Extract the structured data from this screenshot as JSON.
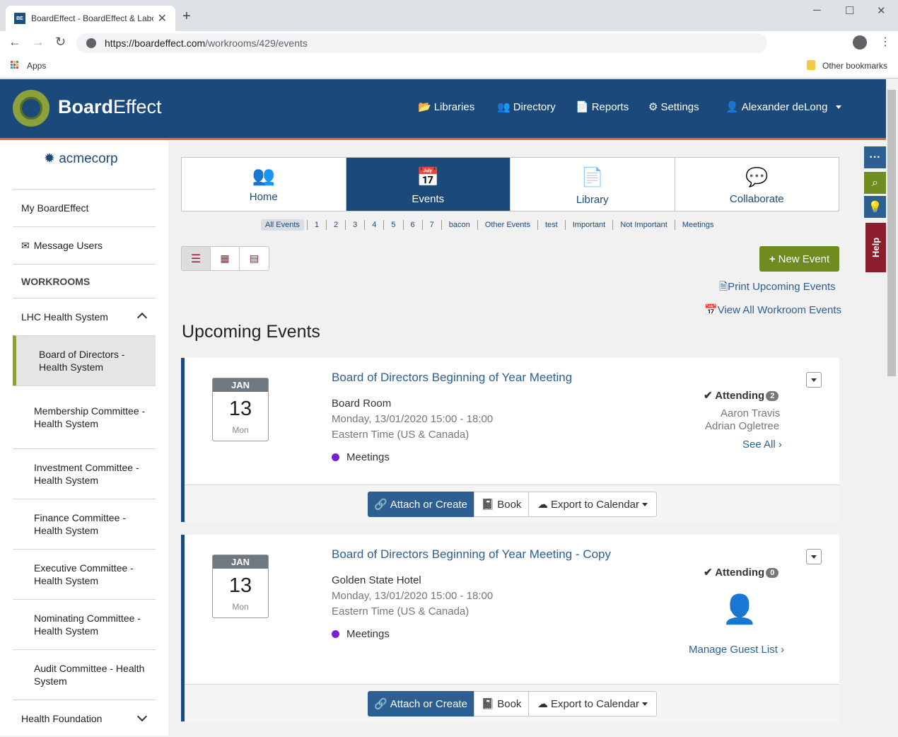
{
  "browser": {
    "tab_title": "BoardEffect - BoardEffect & Labo",
    "favicon_text": "BE",
    "url_host": "https://boardeffect.com",
    "url_path": "/workrooms/429/events",
    "bookmarks_apps": "Apps",
    "bookmarks_other": "Other bookmarks"
  },
  "header": {
    "logo_board": "Board",
    "logo_effect": "Effect",
    "nav": {
      "libraries": "Libraries",
      "directory": "Directory",
      "reports": "Reports",
      "settings": "Settings",
      "user": "Alexander deLong"
    }
  },
  "sidebar": {
    "brand": "acmecorp",
    "my_boardeffect": "My BoardEffect",
    "message_users": "Message Users",
    "workrooms_heading": "WORKROOMS",
    "group1": "LHC Health System",
    "items": [
      "Board of Directors - Health System",
      "Membership Committee - Health System",
      "Investment Committee - Health System",
      "Finance Committee - Health System",
      "Executive Committee - Health System",
      "Nominating Committee - Health System",
      "Audit Committee - Health System"
    ],
    "group2": "Health Foundation"
  },
  "tabs": {
    "home": "Home",
    "events": "Events",
    "library": "Library",
    "collaborate": "Collaborate"
  },
  "filters": [
    "All Events",
    "1",
    "2",
    "3",
    "4",
    "5",
    "6",
    "7",
    "bacon",
    "Other Events",
    "test",
    "Important",
    "Not Important",
    "Meetings"
  ],
  "actions": {
    "new_event": "New Event",
    "print_upcoming": "Print Upcoming Events",
    "view_all": "View All Workroom Events"
  },
  "section_title": "Upcoming Events",
  "events": [
    {
      "month": "JAN",
      "day": "13",
      "weekday": "Mon",
      "title": "Board of Directors Beginning of Year Meeting",
      "location": "Board Room",
      "time": "Monday, 13/01/2020 15:00 - 18:00",
      "timezone": "Eastern Time (US & Canada)",
      "category": "Meetings",
      "attending_label": "Attending",
      "attending_count": "2",
      "attendees": [
        "Aaron Travis",
        "Adrian Ogletree"
      ],
      "see_all": "See All ›"
    },
    {
      "month": "JAN",
      "day": "13",
      "weekday": "Mon",
      "title": "Board of Directors Beginning of Year Meeting - Copy",
      "location": "Golden State Hotel",
      "time": "Monday, 13/01/2020 15:00 - 18:00",
      "timezone": "Eastern Time (US & Canada)",
      "category": "Meetings",
      "attending_label": "Attending",
      "attending_count": "0",
      "manage_guests": "Manage Guest List ›"
    }
  ],
  "card_buttons": {
    "attach": "Attach or Create",
    "book": "Book",
    "export": "Export to Calendar"
  },
  "help": "Help",
  "colors": {
    "header": "#1b4a7a",
    "accent_orange": "#e16a2a",
    "green": "#6e8c1f",
    "link": "#2d5f92",
    "category_dot": "#7a1fd6"
  }
}
